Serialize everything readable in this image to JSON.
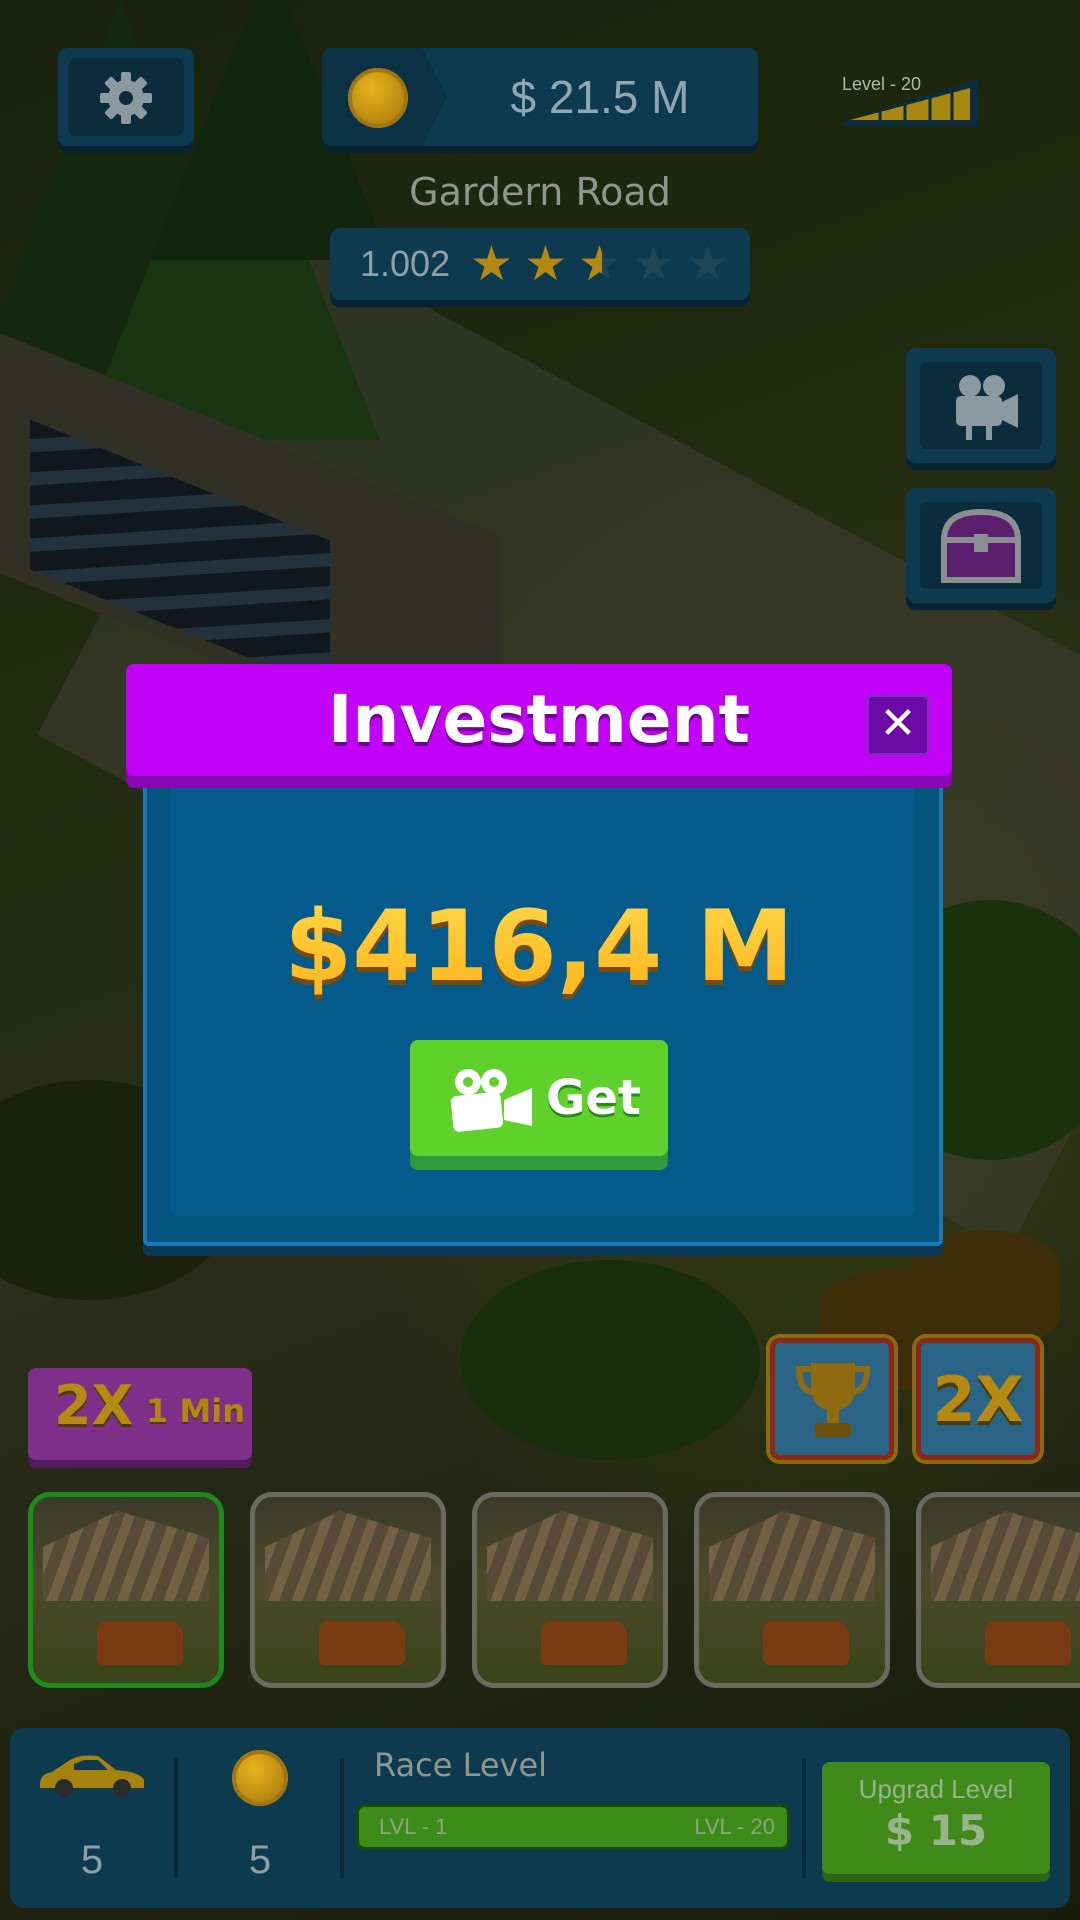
{
  "hud": {
    "money": "$ 21.5 M",
    "level_label": "Level - 20",
    "road_name": "Gardern Road",
    "rating_value": "1.002",
    "rating_stars": 2.5,
    "rating_max": 5
  },
  "modal": {
    "title": "Investment",
    "close_glyph": "✕",
    "amount": "$416,4 M",
    "get_label": "Get"
  },
  "boosts": {
    "double_multiplier": "2X",
    "double_duration": "1 Min",
    "x2_button": "2X"
  },
  "garage": {
    "slots": 5,
    "active_slot": 0
  },
  "bottom": {
    "cars_count": "5",
    "coins_count": "5",
    "race_title": "Race Level",
    "lvl_start": "LVL - 1",
    "lvl_end": "LVL - 20",
    "upgrade_title": "Upgrad Level",
    "upgrade_price": "$ 15"
  },
  "colors": {
    "modal_header": "#c200f7",
    "modal_body": "#04537f",
    "amount_gold": "#ffbe1a",
    "get_green": "#5fd12a",
    "hud_panel": "#0e3a4f"
  },
  "icons": [
    "gear-icon",
    "coin-icon",
    "level-meter-icon",
    "star-icon",
    "video-camera-icon",
    "treasure-chest-icon",
    "close-icon",
    "trophy-icon",
    "car-icon"
  ]
}
